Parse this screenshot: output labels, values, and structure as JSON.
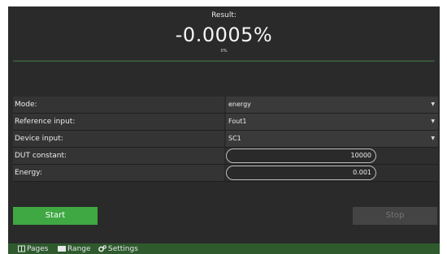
{
  "result": {
    "label": "Result:",
    "value": "-0.0005%",
    "progress_text": "0%",
    "progress": 0
  },
  "form": {
    "rows": [
      {
        "label": "Mode:",
        "value": "energy",
        "kind": "select"
      },
      {
        "label": "Reference input:",
        "value": "Fout1",
        "kind": "select"
      },
      {
        "label": "Device input:",
        "value": "SC1",
        "kind": "select"
      },
      {
        "label": "DUT constant:",
        "value": "10000",
        "kind": "number"
      },
      {
        "label": "Energy:",
        "value": "0.001",
        "kind": "number"
      }
    ]
  },
  "buttons": {
    "start": "Start",
    "stop": "Stop"
  },
  "bottom_nav": {
    "pages": "Pages",
    "range": "Range",
    "settings": "Settings"
  },
  "colors": {
    "background": "#2a2a2a",
    "start_button": "#3fa843",
    "stop_button_disabled": "#444444",
    "bottom_bar": "#2e5a2e"
  }
}
